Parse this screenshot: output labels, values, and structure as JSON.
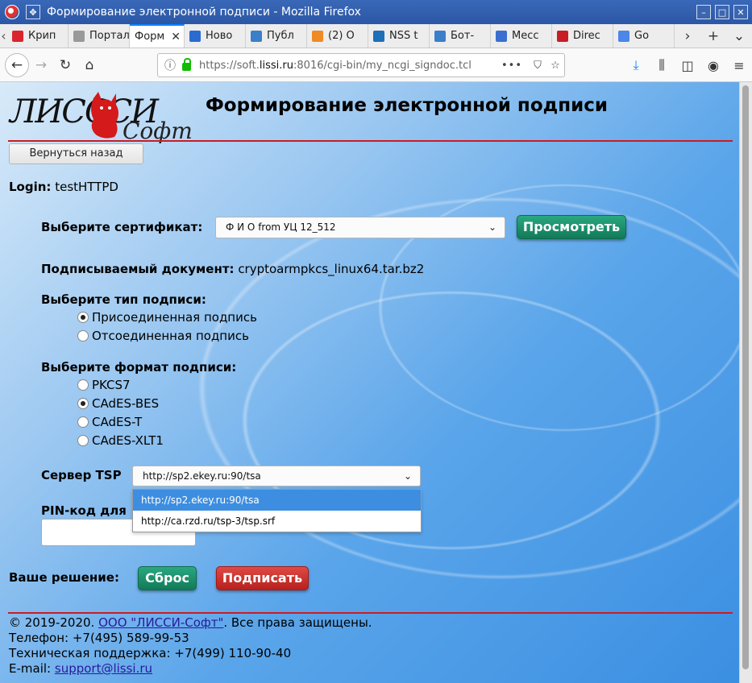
{
  "window": {
    "title": "Формирование электронной подписи - Mozilla Firefox",
    "controls": {
      "minimize": "–",
      "maximize": "□",
      "close": "✕"
    }
  },
  "tabs": [
    {
      "label": "Крип",
      "color": "#d9262e"
    },
    {
      "label": "Портал",
      "color": "#999999"
    },
    {
      "label": "Форм",
      "color": "#ffffff",
      "active": true
    },
    {
      "label": "Ново",
      "color": "#2a6bd0"
    },
    {
      "label": "Публ",
      "color": "#3a7fc9"
    },
    {
      "label": "(2) О",
      "color": "#f08a24"
    },
    {
      "label": "NSS t",
      "color": "#1d6fb8"
    },
    {
      "label": "Бот-",
      "color": "#3a7fc9"
    },
    {
      "label": "Месс",
      "color": "#3a6fd0"
    },
    {
      "label": "Direc",
      "color": "#c81d25"
    },
    {
      "label": "Go",
      "color": "#4b86e8"
    }
  ],
  "navbar": {
    "url_prefix": "https://soft.",
    "url_domain": "lissi.ru",
    "url_suffix": ":8016/cgi-bin/my_ncgi_signdoc.tcl",
    "more": "•••"
  },
  "page": {
    "logo_text": "ЛИСССИ",
    "logo_sub": "Софт",
    "heading": "Формирование электронной подписи",
    "back_button": "Вернуться назад",
    "login_label": "Login:",
    "login_value": "testHTTPD",
    "cert_label": "Выберите сертификат:",
    "cert_value": "Ф И О from УЦ 12_512",
    "view_button": "Просмотреть",
    "doc_label": "Подписываемый документ:",
    "doc_value": "cryptoarmpkcs_linux64.tar.bz2",
    "sigtype_label": "Выберите тип подписи:",
    "sigtypes": [
      {
        "label": "Присоединенная подпись",
        "checked": true
      },
      {
        "label": "Отсоединенная подпись",
        "checked": false
      }
    ],
    "format_label": "Выберите формат подписи:",
    "formats": [
      {
        "label": "PKCS7",
        "checked": false
      },
      {
        "label": "CAdES-BES",
        "checked": true
      },
      {
        "label": "CAdES-T",
        "checked": false
      },
      {
        "label": "CAdES-XLT1",
        "checked": false
      }
    ],
    "tsp_label": "Сервер TSP",
    "tsp_value": "http://sp2.ekey.ru:90/tsa",
    "tsp_options": [
      "http://sp2.ekey.ru:90/tsa",
      "http://ca.rzd.ru/tsp-3/tsp.srf"
    ],
    "pin_label": "PIN-код для",
    "decision_label": "Ваше решение:",
    "reset_button": "Сброс",
    "sign_button": "Подписать",
    "footer": {
      "copyright_pre": "© 2019-2020.",
      "company_link": "ООО \"ЛИССИ-Софт\"",
      "copyright_post": ". Все права защищены.",
      "phone": "Телефон: +7(495) 589-99-53",
      "support_phone": "Техническая поддержка: +7(499) 110-90-40",
      "email_label": "E-mail:",
      "email": "support@lissi.ru"
    }
  }
}
